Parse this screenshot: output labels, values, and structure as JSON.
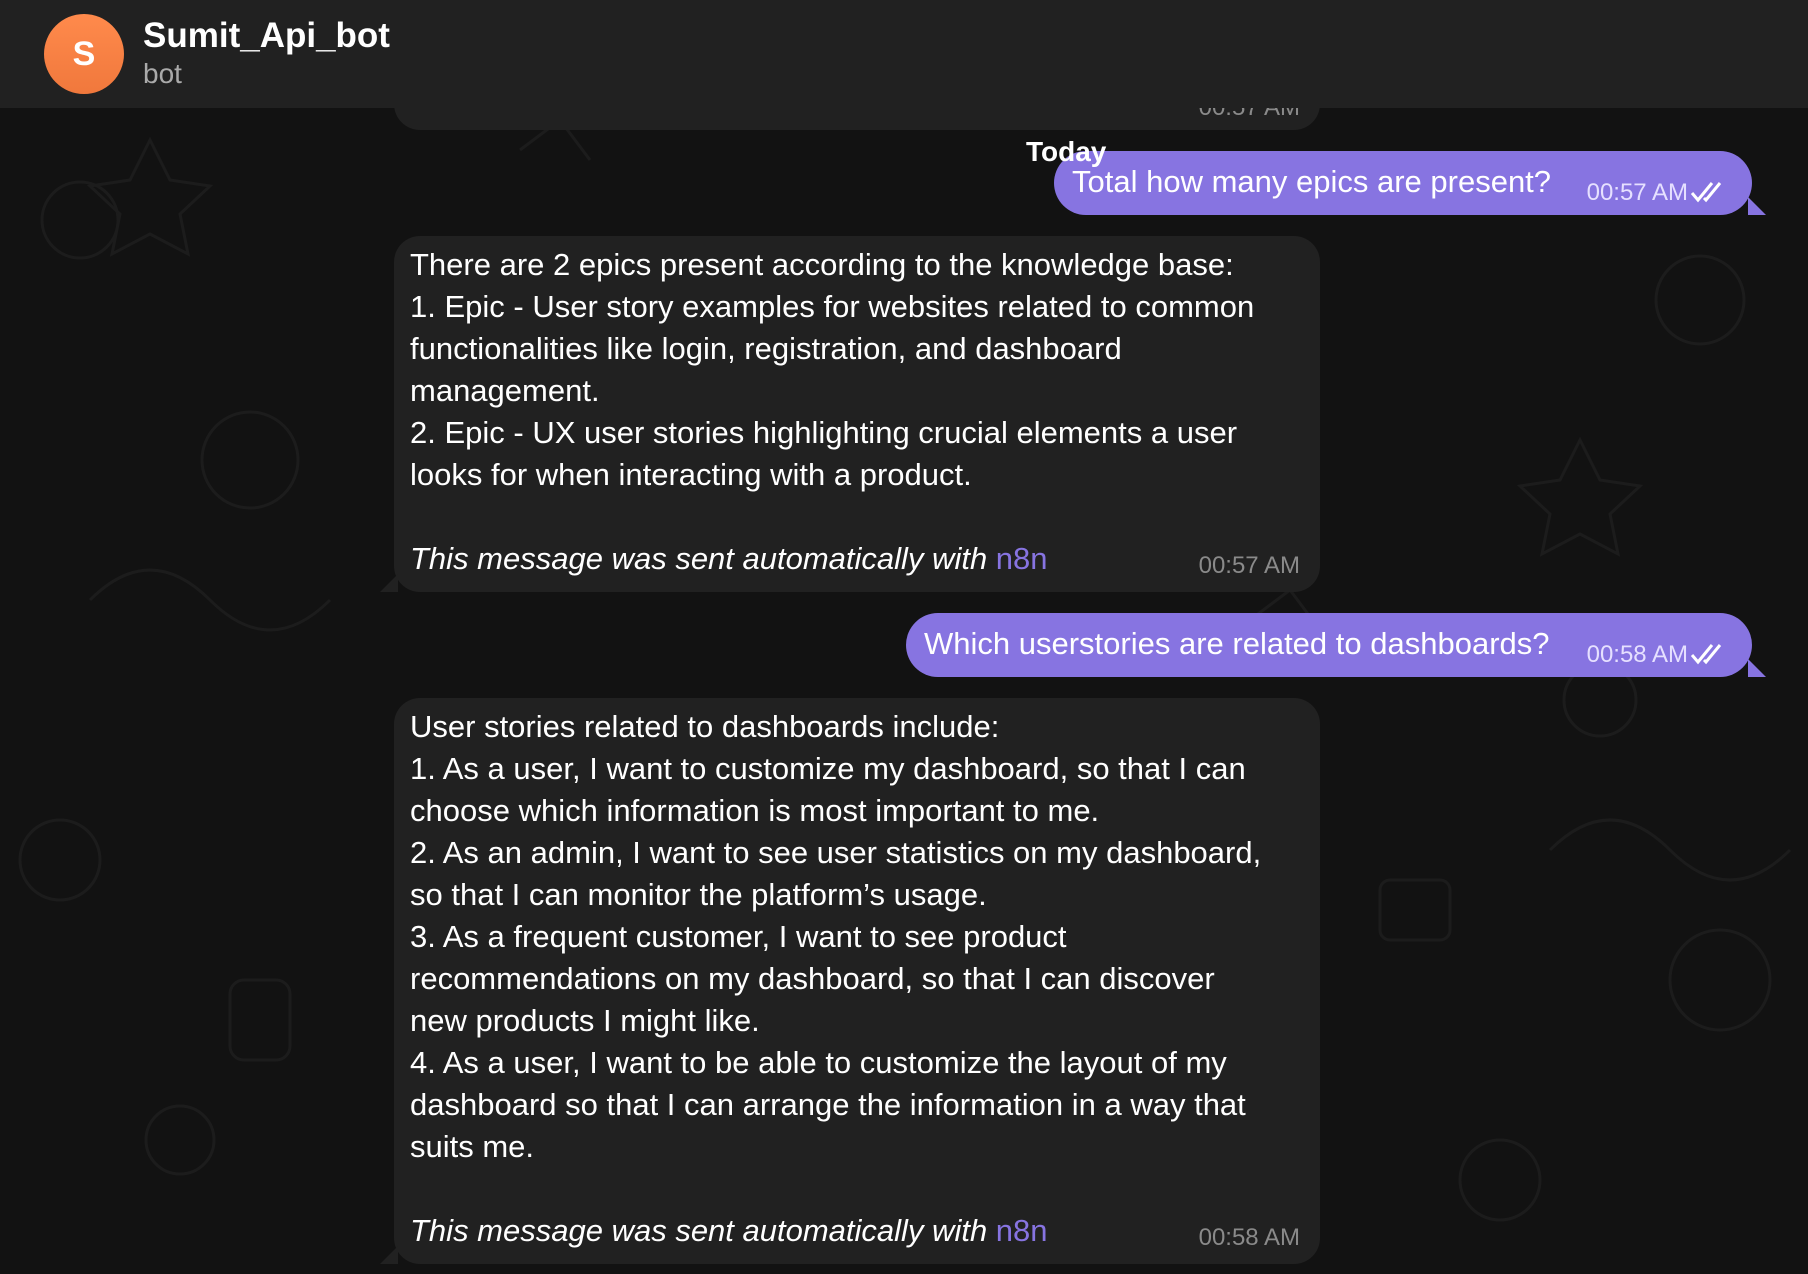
{
  "header": {
    "avatar_letter": "S",
    "title": "Sumit_Api_bot",
    "status": "bot"
  },
  "date_separator": "Today",
  "previous_message": {
    "time": "00:57 AM"
  },
  "messages": [
    {
      "direction": "out",
      "text": "Total how many epics are present?",
      "time": "00:57 AM",
      "read": true
    },
    {
      "direction": "in",
      "lines": [
        "There are 2 epics present according to the knowledge base:",
        "1. Epic - User story examples for websites related to common",
        "functionalities like login, registration, and dashboard",
        "management.",
        "2. Epic - UX user stories highlighting crucial elements a user",
        "looks for when interacting with a product."
      ],
      "footer_text": "This message was sent automatically with ",
      "footer_link": "n8n",
      "time": "00:57 AM"
    },
    {
      "direction": "out",
      "text": "Which userstories are related to dashboards?",
      "time": "00:58 AM",
      "read": true
    },
    {
      "direction": "in",
      "lines": [
        "User stories related to dashboards include:",
        "1. As a user, I want to customize my dashboard, so that I can",
        "choose which information is most important to me.",
        "2. As an admin, I want to see user statistics on my dashboard,",
        "so that I can monitor the platform’s usage.",
        "3. As a frequent customer, I want to see product",
        "recommendations on my dashboard, so that I can discover",
        "new products I might like.",
        "4. As a user, I want to be able to customize the layout of my",
        "dashboard so that I can arrange the information in a way that",
        "suits me."
      ],
      "footer_text": "This message was sent automatically with ",
      "footer_link": "n8n",
      "time": "00:58 AM"
    }
  ],
  "colors": {
    "background": "#121212",
    "bubble_incoming": "#212121",
    "bubble_outgoing": "#8774e1",
    "link": "#8774e1",
    "avatar": "#f0783c"
  },
  "icons": {
    "read_receipt": "double-check-icon"
  }
}
